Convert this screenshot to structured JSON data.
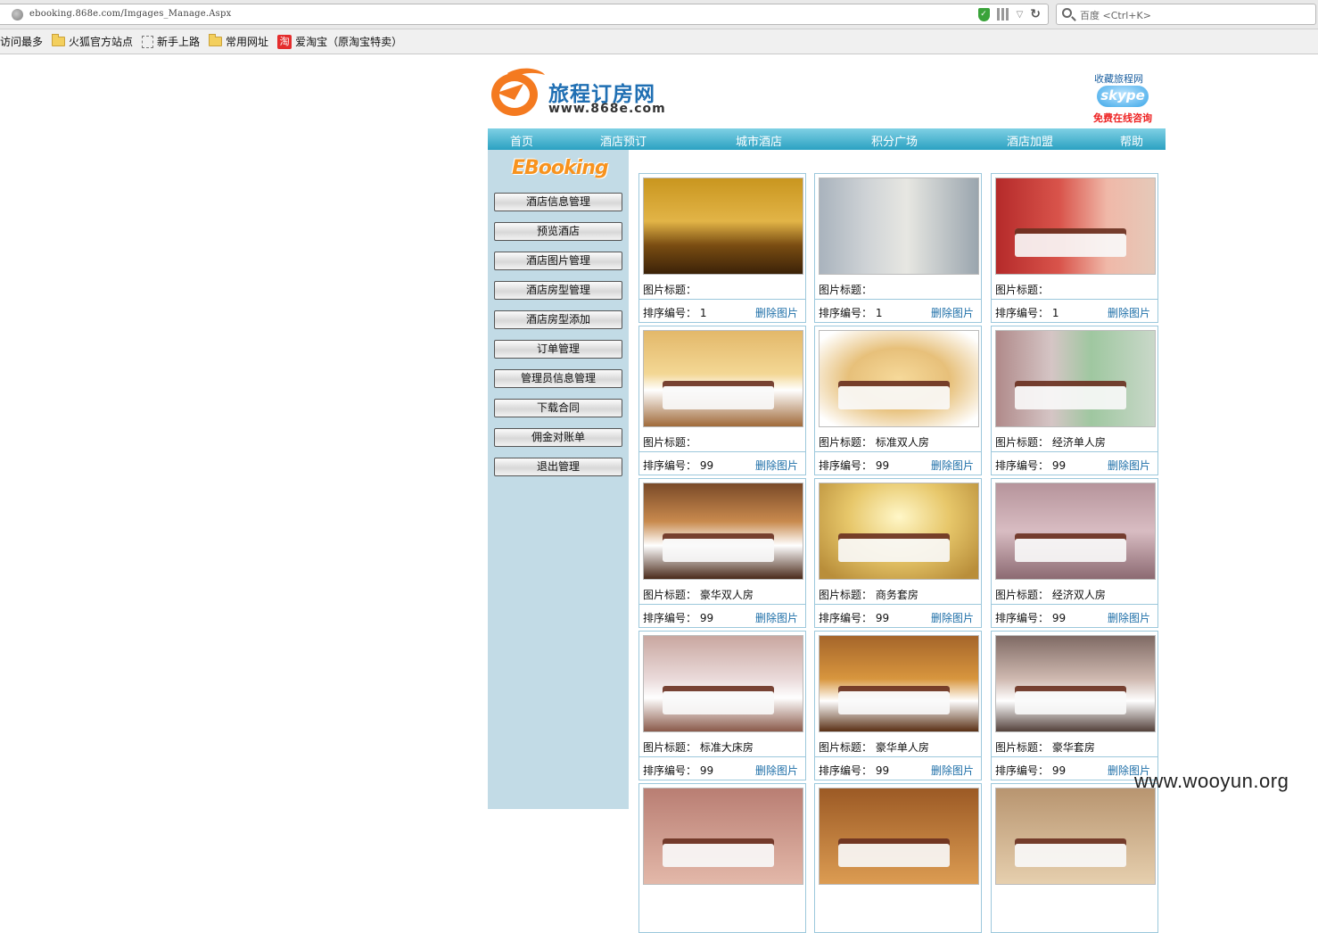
{
  "browser": {
    "url": "ebooking.868e.com/Imgages_Manage.Aspx",
    "search_placeholder": "百度 <Ctrl+K>"
  },
  "bookmarks": [
    "访问最多",
    "火狐官方站点",
    "新手上路",
    "常用网址",
    "爱淘宝（原淘宝特卖）"
  ],
  "header": {
    "logo_cn": "旅程订房网",
    "logo_url": "www.868e.com",
    "favorite": "收藏旅程网",
    "skype": "skype",
    "consult": "免费在线咨询"
  },
  "nav": [
    "首页",
    "酒店预订",
    "城市酒店",
    "积分广场",
    "酒店加盟",
    "帮助"
  ],
  "sidebar": {
    "brand": "EBooking",
    "buttons": [
      "酒店信息管理",
      "预览酒店",
      "酒店图片管理",
      "酒店房型管理",
      "酒店房型添加",
      "订单管理",
      "管理员信息管理",
      "下载合同",
      "佣金对账单",
      "退出管理"
    ]
  },
  "labels": {
    "title_prefix": "图片标题：",
    "order_prefix": "排序编号：",
    "delete": "删除图片"
  },
  "images": [
    {
      "title": "",
      "order": "1",
      "photo": "lobby-reception"
    },
    {
      "title": "",
      "order": "1",
      "photo": "building-exterior"
    },
    {
      "title": "",
      "order": "1",
      "photo": "red-wall-room"
    },
    {
      "title": "",
      "order": "99",
      "photo": "twin-room-warm"
    },
    {
      "title": "标准双人房",
      "order": "99",
      "photo": "twin-room-vignette"
    },
    {
      "title": "经济单人房",
      "order": "99",
      "photo": "single-room-mural"
    },
    {
      "title": "豪华双人房",
      "order": "99",
      "photo": "deluxe-double-room"
    },
    {
      "title": "商务套房",
      "order": "99",
      "photo": "business-suite-lounge"
    },
    {
      "title": "经济双人房",
      "order": "99",
      "photo": "economy-double-room"
    },
    {
      "title": "标准大床房",
      "order": "99",
      "photo": "standard-king-room"
    },
    {
      "title": "豪华单人房",
      "order": "99",
      "photo": "deluxe-single-room"
    },
    {
      "title": "豪华套房",
      "order": "99",
      "photo": "deluxe-suite"
    },
    {
      "title": "",
      "order": "",
      "photo": "partial-room-1"
    },
    {
      "title": "",
      "order": "",
      "photo": "partial-room-2"
    },
    {
      "title": "",
      "order": "",
      "photo": "partial-room-3"
    }
  ],
  "watermark": "www.wooyun.org",
  "colors": {
    "nav_top": "#7fd0e4",
    "nav_bottom": "#2ba1c2",
    "sidebar_bg": "#c2dbe6",
    "card_border": "#9cc8dc",
    "link": "#1e6fa8",
    "brand_orange": "#f7931e"
  }
}
